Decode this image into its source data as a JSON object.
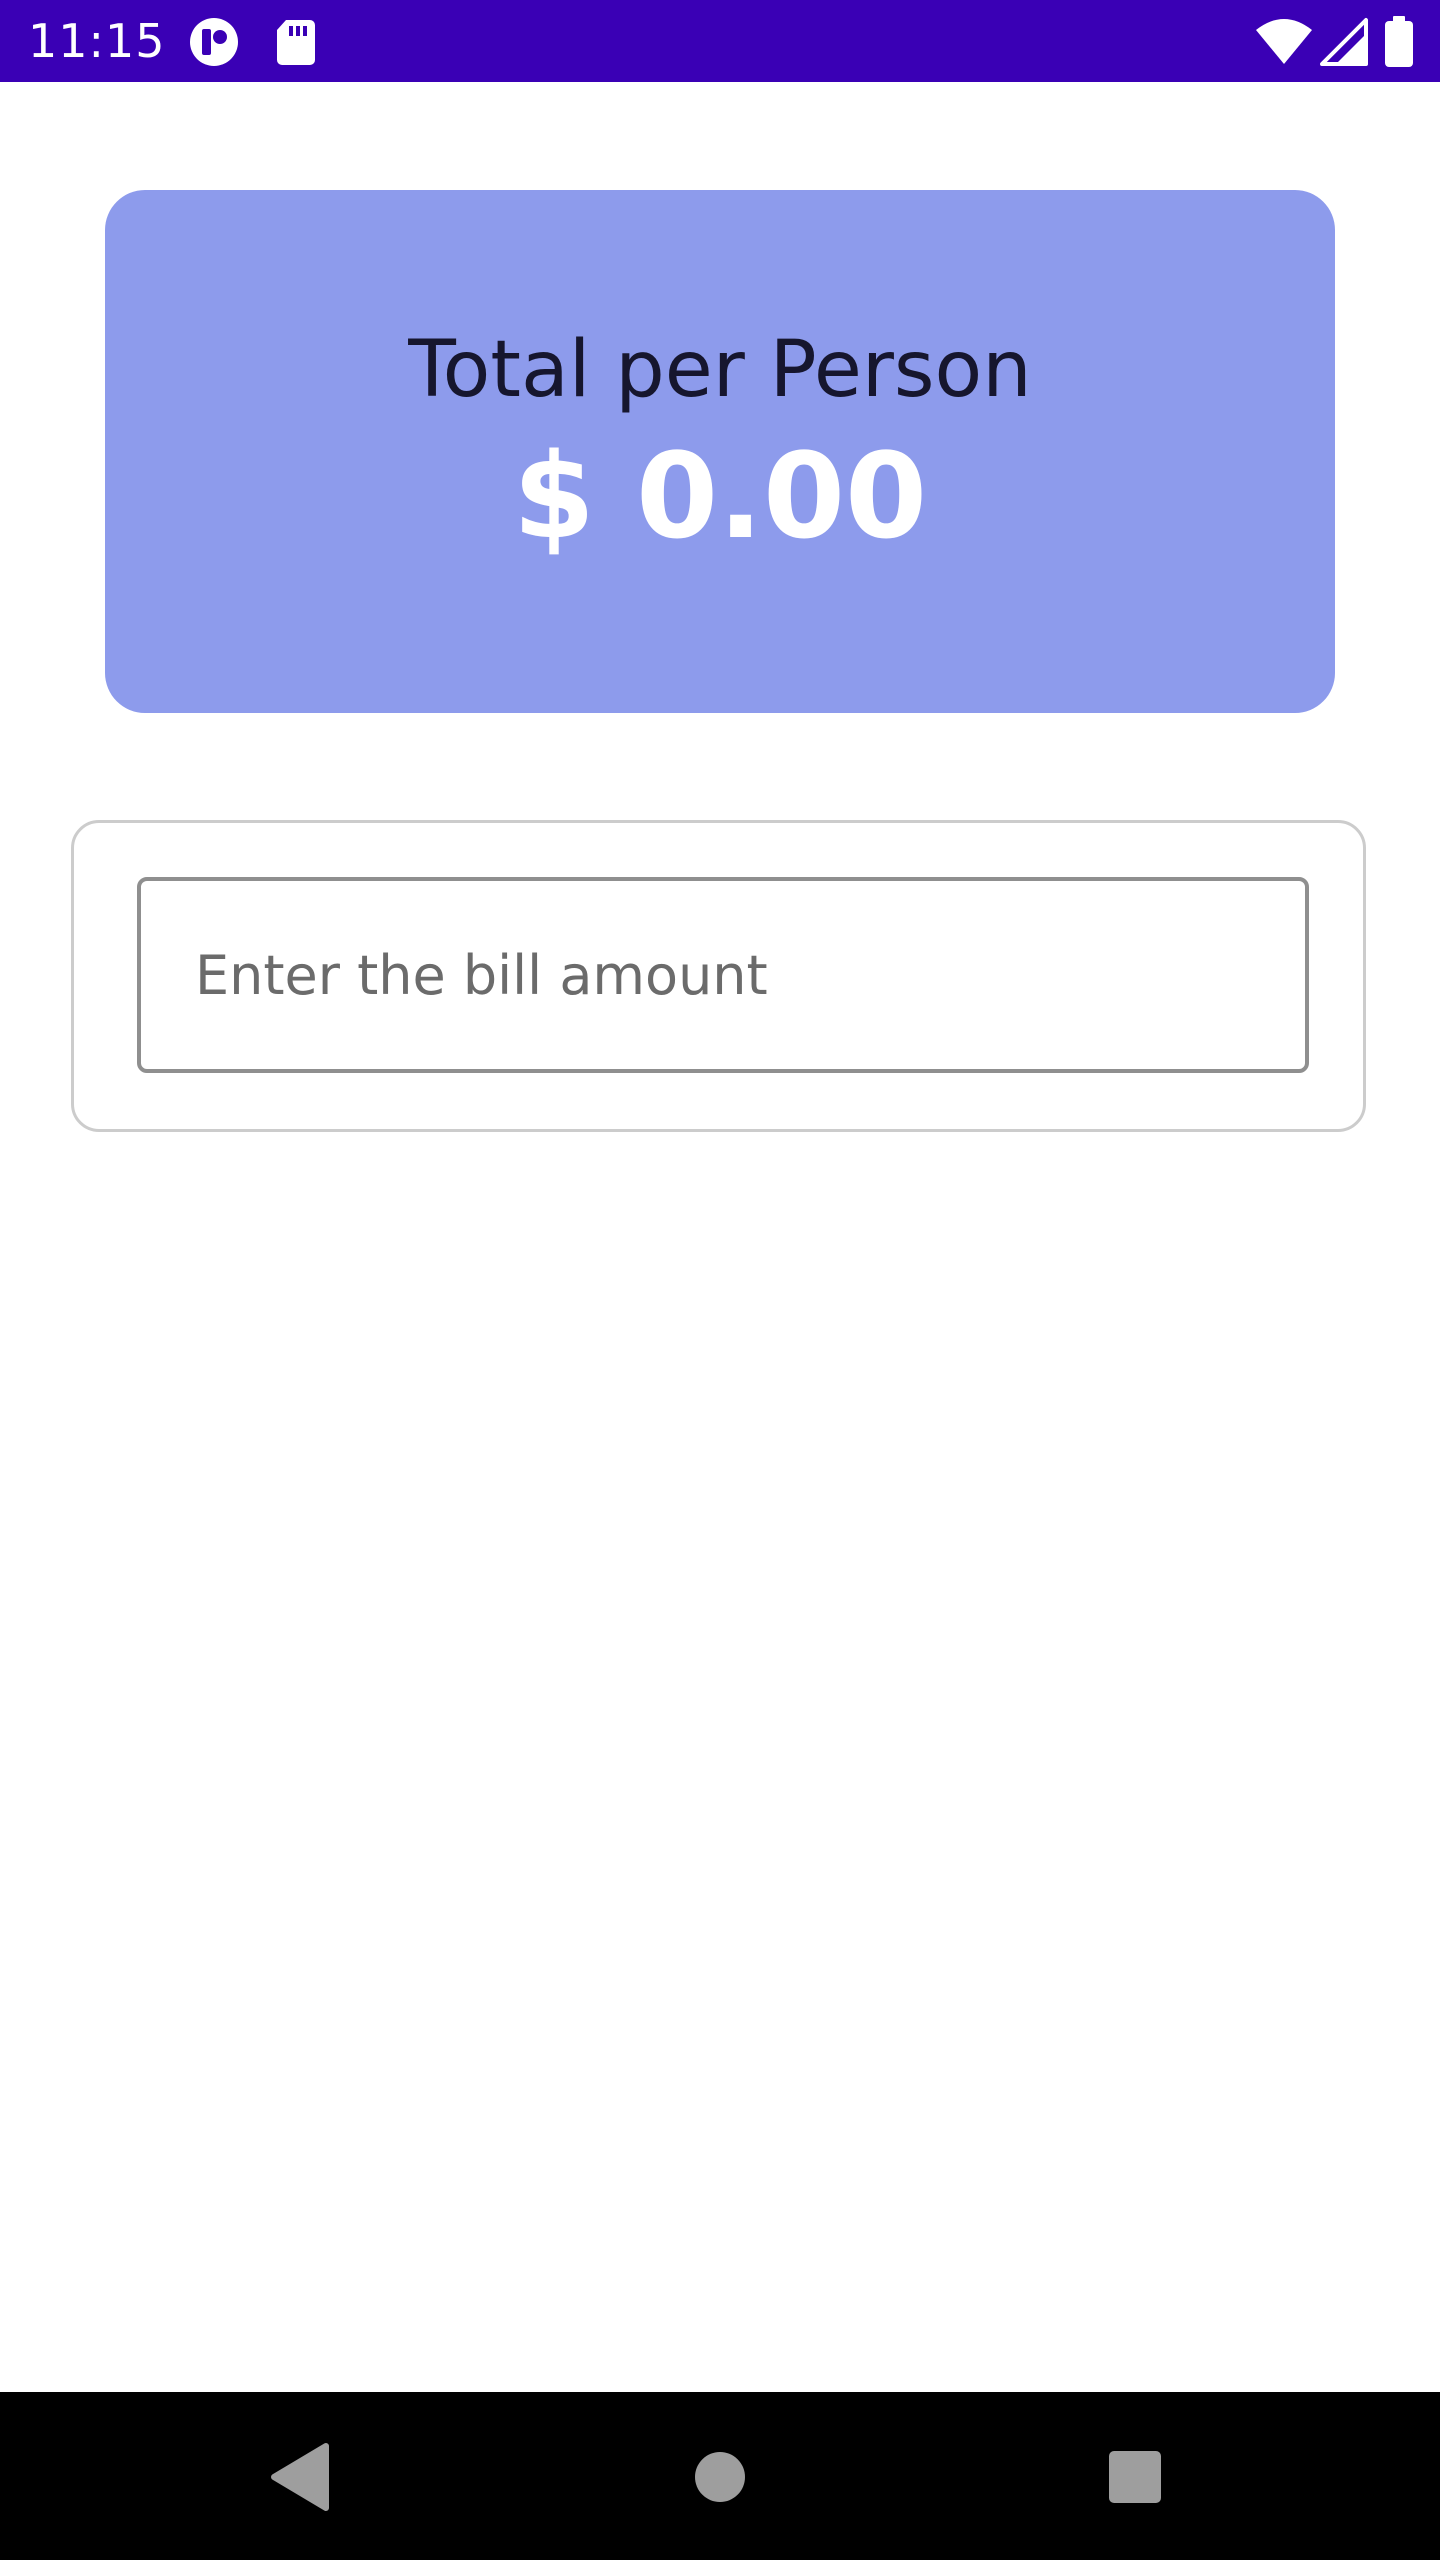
{
  "status_bar": {
    "time": "11:15",
    "background": "#3a00b5",
    "icons": [
      "app-notification-icon",
      "sd-card-icon",
      "wifi-icon",
      "cell-signal-icon",
      "battery-icon"
    ]
  },
  "total_card": {
    "label": "Total per Person",
    "value": "$ 0.00",
    "background": "#8d9bec"
  },
  "bill_input": {
    "placeholder": "Enter the bill amount",
    "value": ""
  },
  "nav_bar": {
    "buttons": [
      "back-icon",
      "home-icon",
      "recents-icon"
    ]
  }
}
